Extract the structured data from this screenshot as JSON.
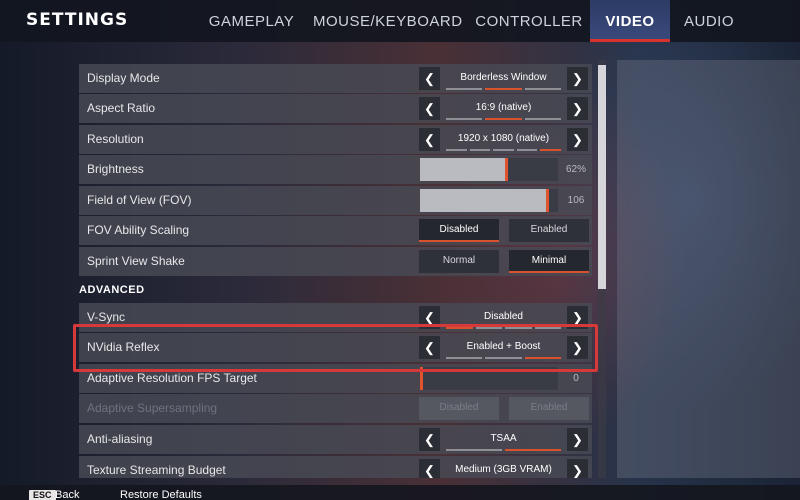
{
  "header": {
    "title": "SETTINGS",
    "tabs": [
      {
        "label": "GAMEPLAY",
        "active": false
      },
      {
        "label": "MOUSE/KEYBOARD",
        "active": false
      },
      {
        "label": "CONTROLLER",
        "active": false
      },
      {
        "label": "VIDEO",
        "active": true
      },
      {
        "label": "AUDIO",
        "active": false
      }
    ]
  },
  "settings": {
    "display_mode": {
      "label": "Display Mode",
      "value": "Borderless Window",
      "dashes": 3,
      "active_dash": 2
    },
    "aspect_ratio": {
      "label": "Aspect Ratio",
      "value": "16:9 (native)",
      "dashes": 3,
      "active_dash": 2
    },
    "resolution": {
      "label": "Resolution",
      "value": "1920 x 1080 (native)",
      "dashes": 5,
      "active_dash": 5
    },
    "brightness": {
      "label": "Brightness",
      "value_text": "62%",
      "level_percent": 62
    },
    "fov": {
      "label": "Field of View (FOV)",
      "value_text": "106",
      "level_percent": 92
    },
    "fov_ability_scaling": {
      "label": "FOV Ability Scaling",
      "options": [
        "Disabled",
        "Enabled"
      ],
      "selected": "Disabled"
    },
    "sprint_view_shake": {
      "label": "Sprint View Shake",
      "options": [
        "Normal",
        "Minimal"
      ],
      "selected": "Minimal"
    },
    "advanced_header": "ADVANCED",
    "vsync": {
      "label": "V-Sync",
      "value": "Disabled",
      "dashes": 4,
      "active_dash": 1
    },
    "nvidia_reflex": {
      "label": "NVidia Reflex",
      "value": "Enabled + Boost",
      "dashes": 3,
      "active_dash": 3
    },
    "adaptive_resolution": {
      "label": "Adaptive Resolution FPS Target",
      "value_text": "0",
      "level_percent": 0
    },
    "adaptive_supersampling": {
      "label": "Adaptive Supersampling",
      "options": [
        "Disabled",
        "Enabled"
      ],
      "selected": "Disabled",
      "disabled": true
    },
    "anti_aliasing": {
      "label": "Anti-aliasing",
      "value": "TSAA",
      "dashes": 2,
      "active_dash": 2
    },
    "texture_streaming": {
      "label": "Texture Streaming Budget",
      "value": "Medium (3GB VRAM)",
      "dashes": 5,
      "active_dash": 3
    }
  },
  "footer": {
    "esc_key": "ESC",
    "back_label": "Back",
    "restore_label": "Restore Defaults"
  },
  "colors": {
    "accent": "#d8522e",
    "highlight_box": "#d5393a",
    "active_tab_bg": "#3a4a7c"
  },
  "icons": {
    "arrow_left": "chevron-left-icon",
    "arrow_right": "chevron-right-icon"
  }
}
